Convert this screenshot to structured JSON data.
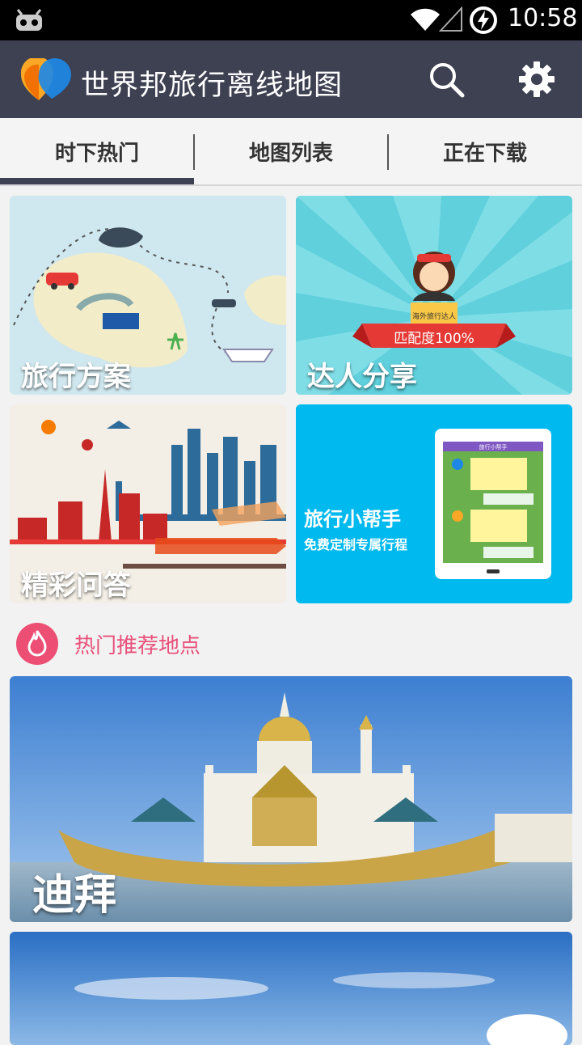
{
  "status_bar": {
    "time": "10:58"
  },
  "app_bar": {
    "title": "世界邦旅行离线地图"
  },
  "tabs": [
    {
      "label": "时下热门",
      "active": true
    },
    {
      "label": "地图列表",
      "active": false
    },
    {
      "label": "正在下载",
      "active": false
    }
  ],
  "cards": {
    "plan": {
      "label": "旅行方案"
    },
    "share": {
      "label": "达人分享",
      "badge": "海外旅行达人",
      "ribbon": "匹配度100%"
    },
    "qa": {
      "label": "精彩问答"
    },
    "helper": {
      "label": "旅行小帮手",
      "sublabel": "免费定制专属行程",
      "screen_title": "旅行小帮手"
    }
  },
  "section": {
    "title": "热门推荐地点"
  },
  "destinations": [
    {
      "name": "迪拜"
    },
    {
      "name": ""
    }
  ],
  "colors": {
    "status_bar": "#000000",
    "app_bar": "#3e4152",
    "tab_indicator": "#3e4152",
    "accent_pink": "#e8507a",
    "helper_blue": "#00b9ee",
    "share_teal": "#5fd0dc"
  }
}
